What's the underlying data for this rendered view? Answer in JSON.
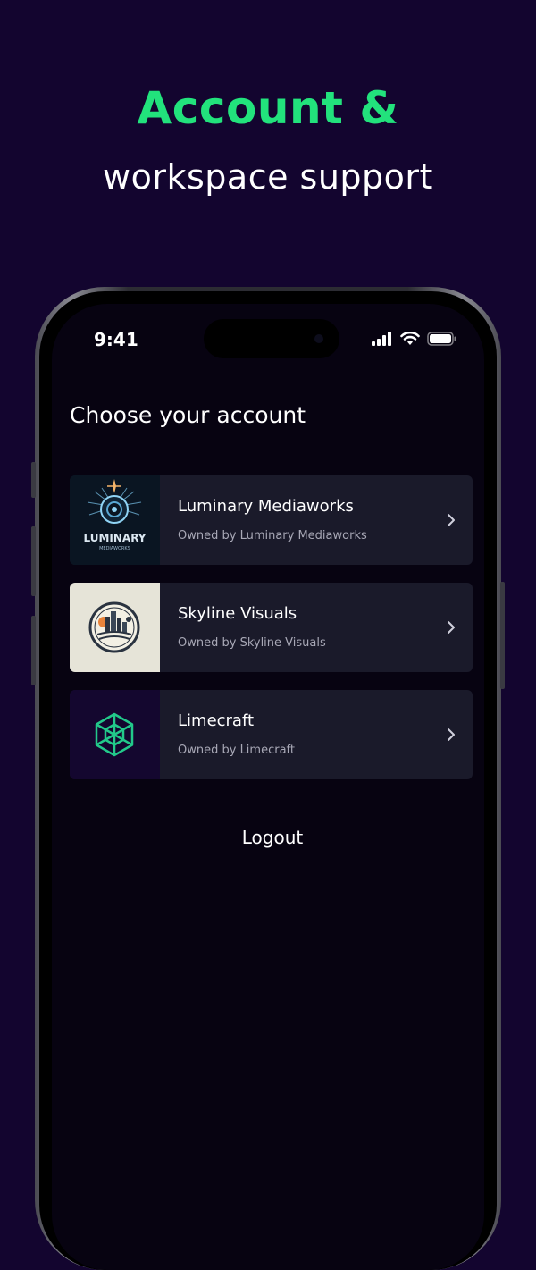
{
  "promo": {
    "title": "Account &",
    "subtitle": "workspace support"
  },
  "status_bar": {
    "time": "9:41",
    "icons": [
      "signal-icon",
      "wifi-icon",
      "battery-icon"
    ]
  },
  "screen": {
    "title": "Choose your account"
  },
  "accounts": [
    {
      "name": "Luminary Mediaworks",
      "owner": "Owned by Luminary Mediaworks",
      "logo_text": "LUMINARY",
      "logo_subtext": "MEDIAWORKS",
      "icon": "luminary-logo-icon"
    },
    {
      "name": "Skyline Visuals",
      "owner": "Owned by Skyline Visuals",
      "icon": "skyline-logo-icon"
    },
    {
      "name": "Limecraft",
      "owner": "Owned by Limecraft",
      "icon": "limecraft-logo-icon"
    }
  ],
  "logout_label": "Logout",
  "colors": {
    "background": "#13052f",
    "accent": "#22e27c",
    "screen_bg": "#070311",
    "card_bg": "#1a1a2a"
  }
}
